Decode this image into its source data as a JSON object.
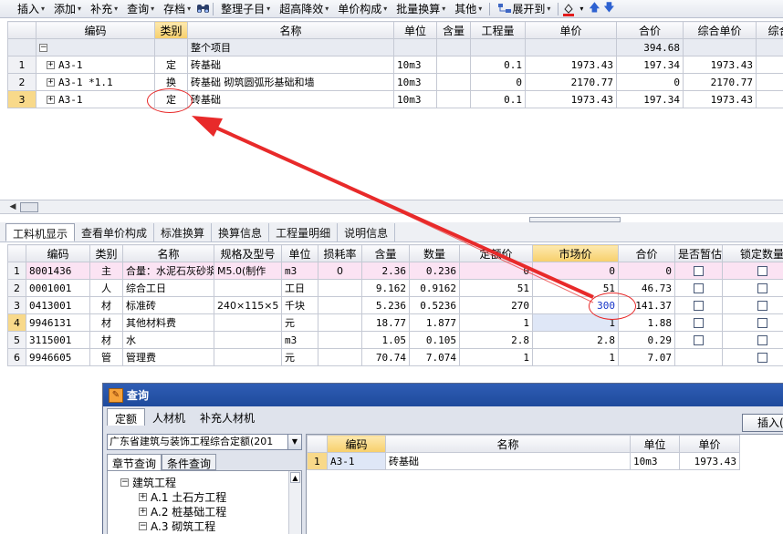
{
  "toolbar": {
    "items": [
      {
        "label": "插入",
        "arrow": "▾"
      },
      {
        "label": "添加",
        "arrow": "▾"
      },
      {
        "label": "补充",
        "arrow": "▾"
      },
      {
        "label": "查询",
        "arrow": "▾"
      },
      {
        "label": "存档",
        "arrow": "▾"
      },
      {
        "label": "整理子目",
        "arrow": "▾"
      },
      {
        "label": "超高降效",
        "arrow": "▾"
      },
      {
        "label": "单价构成",
        "arrow": "▾"
      },
      {
        "label": "批量换算",
        "arrow": "▾"
      },
      {
        "label": "其他",
        "arrow": "▾"
      },
      {
        "label": "展开到",
        "arrow": "▾"
      }
    ],
    "binoculars_icon": "binoculars-icon",
    "color_icon": "paint-bucket-icon",
    "up": "🡅",
    "down": "🡇"
  },
  "top_grid": {
    "headers": [
      "编码",
      "类别",
      "名称",
      "单位",
      "含量",
      "工程量",
      "单价",
      "合价",
      "综合单价",
      "综合"
    ],
    "group_row": {
      "toggle": "−",
      "name": "整个项目",
      "total": "394.68"
    },
    "rows": [
      {
        "no": "1",
        "code": "A3-1",
        "type": "定",
        "name": "砖基础",
        "unit": "10m3",
        "qty": "",
        "amount": "0.1",
        "price": "1973.43",
        "total": "197.34",
        "comp": "1973.43"
      },
      {
        "no": "2",
        "code": "A3-1 *1.1",
        "type": "换",
        "name": "砖基础 砌筑圆弧形基础和墙",
        "unit": "10m3",
        "qty": "",
        "amount": "0",
        "price": "2170.77",
        "total": "0",
        "comp": "2170.77"
      },
      {
        "no": "3",
        "code": "A3-1",
        "type": "定",
        "name": "砖基础",
        "unit": "10m3",
        "qty": "",
        "amount": "0.1",
        "price": "1973.43",
        "total": "197.34",
        "comp": "1973.43"
      }
    ],
    "expand_sign": "+"
  },
  "tabs": [
    "工料机显示",
    "查看单价构成",
    "标准换算",
    "换算信息",
    "工程量明细",
    "说明信息"
  ],
  "material_grid": {
    "headers": [
      "编码",
      "类别",
      "名称",
      "规格及型号",
      "单位",
      "损耗率",
      "含量",
      "数量",
      "定额价",
      "市场价",
      "合价",
      "是否暂估",
      "锁定数量"
    ],
    "rows": [
      {
        "no": "1",
        "code": "8001436",
        "type": "主",
        "name": "合量：水泥石灰砂浆",
        "spec": "M5.0(制作",
        "unit": "m3",
        "loss": "0",
        "qty": "2.36",
        "count": "0.236",
        "quota": "0",
        "market": "0",
        "total": "0"
      },
      {
        "no": "2",
        "code": "0001001",
        "type": "人",
        "name": "综合工日",
        "spec": "",
        "unit": "工日",
        "loss": "",
        "qty": "9.162",
        "count": "0.9162",
        "quota": "51",
        "market": "51",
        "total": "46.73"
      },
      {
        "no": "3",
        "code": "0413001",
        "type": "材",
        "name": "标准砖",
        "spec": "240×115×5",
        "unit": "千块",
        "loss": "",
        "qty": "5.236",
        "count": "0.5236",
        "quota": "270",
        "market": "300",
        "total": "141.37"
      },
      {
        "no": "4",
        "code": "9946131",
        "type": "材",
        "name": "其他材料费",
        "spec": "",
        "unit": "元",
        "loss": "",
        "qty": "18.77",
        "count": "1.877",
        "quota": "1",
        "market": "1",
        "total": "1.88"
      },
      {
        "no": "5",
        "code": "3115001",
        "type": "材",
        "name": "水",
        "spec": "",
        "unit": "m3",
        "loss": "",
        "qty": "1.05",
        "count": "0.105",
        "quota": "2.8",
        "market": "2.8",
        "total": "0.29"
      },
      {
        "no": "6",
        "code": "9946605",
        "type": "管",
        "name": "管理费",
        "spec": "",
        "unit": "元",
        "loss": "",
        "qty": "70.74",
        "count": "7.074",
        "quota": "1",
        "market": "1",
        "total": "7.07"
      }
    ]
  },
  "query_window": {
    "title": "查询",
    "tabs": [
      "定额",
      "人材机",
      "补充人材机"
    ],
    "insert_label": "插入(",
    "library": "广东省建筑与装饰工程综合定额(201",
    "subtabs": [
      "章节查询",
      "条件查询"
    ],
    "tree": [
      {
        "sign": "−",
        "label": "建筑工程"
      },
      {
        "sign": "+",
        "label": "A.1 土石方工程"
      },
      {
        "sign": "+",
        "label": "A.2 桩基础工程"
      },
      {
        "sign": "−",
        "label": "A.3 砌筑工程"
      }
    ],
    "result_headers": [
      "编码",
      "名称",
      "单位",
      "单价"
    ],
    "result_rows": [
      {
        "no": "1",
        "code": "A3-1",
        "name": "砖基础",
        "unit": "10m3",
        "price": "1973.43"
      }
    ]
  },
  "colors": {
    "annotation": "#e82a2a",
    "highlight_value": "#1634c8",
    "title_bar": "#2f5db5"
  }
}
